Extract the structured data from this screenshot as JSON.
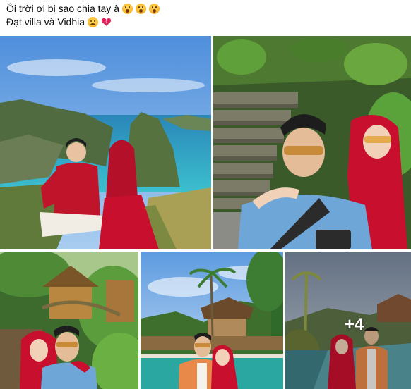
{
  "post": {
    "caption_line1": "Ôi trời ơi bị sao chia tay à",
    "caption_line2": "Đạt villa và Vidhia",
    "line1_emojis": [
      "shocked-face-icon",
      "shocked-face-icon",
      "shocked-face-icon"
    ],
    "line2_emojis": [
      "sad-face-icon",
      "broken-heart-icon"
    ]
  },
  "photos": {
    "more_count": "+4",
    "items": [
      {
        "name": "photo-1",
        "scene": "couple-cliffside-ocean"
      },
      {
        "name": "photo-2",
        "scene": "couple-stone-stairs-garden"
      },
      {
        "name": "photo-3",
        "scene": "couple-tropical-garden-bungalow"
      },
      {
        "name": "photo-4",
        "scene": "couple-pool-palm-trees"
      },
      {
        "name": "photo-5",
        "scene": "couple-infinity-pool"
      }
    ]
  },
  "colors": {
    "sky": "#5d9be0",
    "sea": "#2fa6c4",
    "red_outfit": "#c8102e",
    "blue_shirt": "#6fa6d8"
  }
}
